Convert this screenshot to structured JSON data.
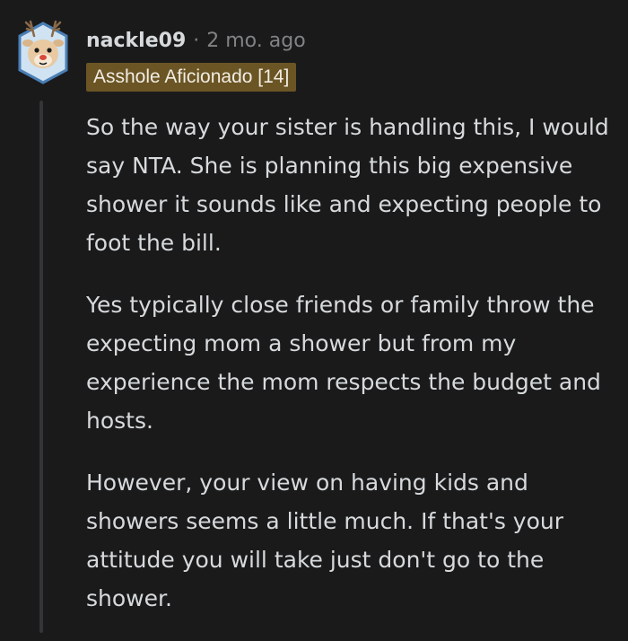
{
  "comment": {
    "username": "nackle09",
    "separator": "·",
    "timestamp": "2 mo. ago",
    "flair": "Asshole Aficionado [14]",
    "paragraphs": [
      "So the way your sister is handling this, I would say NTA. She is planning this big expensive shower it sounds like and expecting people to foot the bill.",
      "Yes typically close friends or family throw the expecting mom a shower but from my experience the mom respects the budget and hosts.",
      "However, your view on having kids and showers seems a little much. If that's your attitude you will take just don't go to the shower."
    ]
  },
  "colors": {
    "background": "#1a1a1b",
    "text": "#d7dadc",
    "meta": "#818384",
    "flair_bg": "#6b5524",
    "avatar_border": "#4a7fb5"
  },
  "icons": {
    "avatar": "deer-snoo-avatar-icon"
  }
}
